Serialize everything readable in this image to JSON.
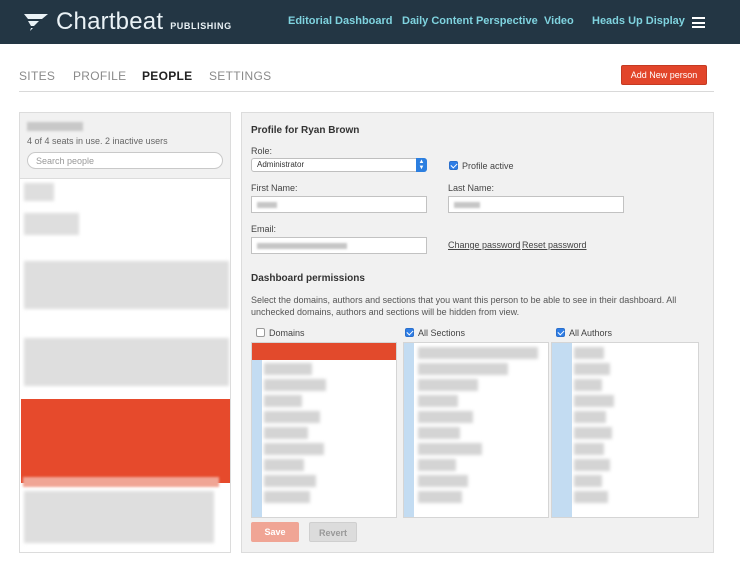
{
  "app": {
    "brand": "Chartbeat",
    "brand_sub": "PUBLISHING"
  },
  "topnav": [
    {
      "label": "Editorial Dashboard"
    },
    {
      "label": "Daily Content Perspective"
    },
    {
      "label": "Video"
    },
    {
      "label": "Heads Up Display"
    }
  ],
  "subnav": {
    "tabs": [
      {
        "label": "SITES",
        "active": false
      },
      {
        "label": "PROFILE",
        "active": false
      },
      {
        "label": "PEOPLE",
        "active": true
      },
      {
        "label": "SETTINGS",
        "active": false
      }
    ],
    "add_button": "Add New person"
  },
  "people_panel": {
    "seats_text": "4 of 4 seats in use. 2 inactive users",
    "search_placeholder": "Search people"
  },
  "profile": {
    "title": "Profile for Ryan Brown",
    "role_label": "Role:",
    "role_value": "Administrator",
    "profile_active_label": "Profile active",
    "profile_active": true,
    "first_name_label": "First Name:",
    "last_name_label": "Last Name:",
    "email_label": "Email:",
    "change_password": "Change password",
    "separator": "|",
    "reset_password": "Reset password"
  },
  "permissions": {
    "title": "Dashboard permissions",
    "description": "Select the domains, authors and sections that you want this person to be able to see in their dashboard. All unchecked domains, authors and sections will be hidden from view.",
    "columns": [
      {
        "label": "Domains",
        "checked": false
      },
      {
        "label": "All Sections",
        "checked": true
      },
      {
        "label": "All Authors",
        "checked": true
      }
    ]
  },
  "actions": {
    "save": "Save",
    "revert": "Revert"
  },
  "colors": {
    "topbar": "#233644",
    "nav_link": "#7fd3df",
    "accent": "#e2452a",
    "checkbox": "#2f7ee6"
  }
}
